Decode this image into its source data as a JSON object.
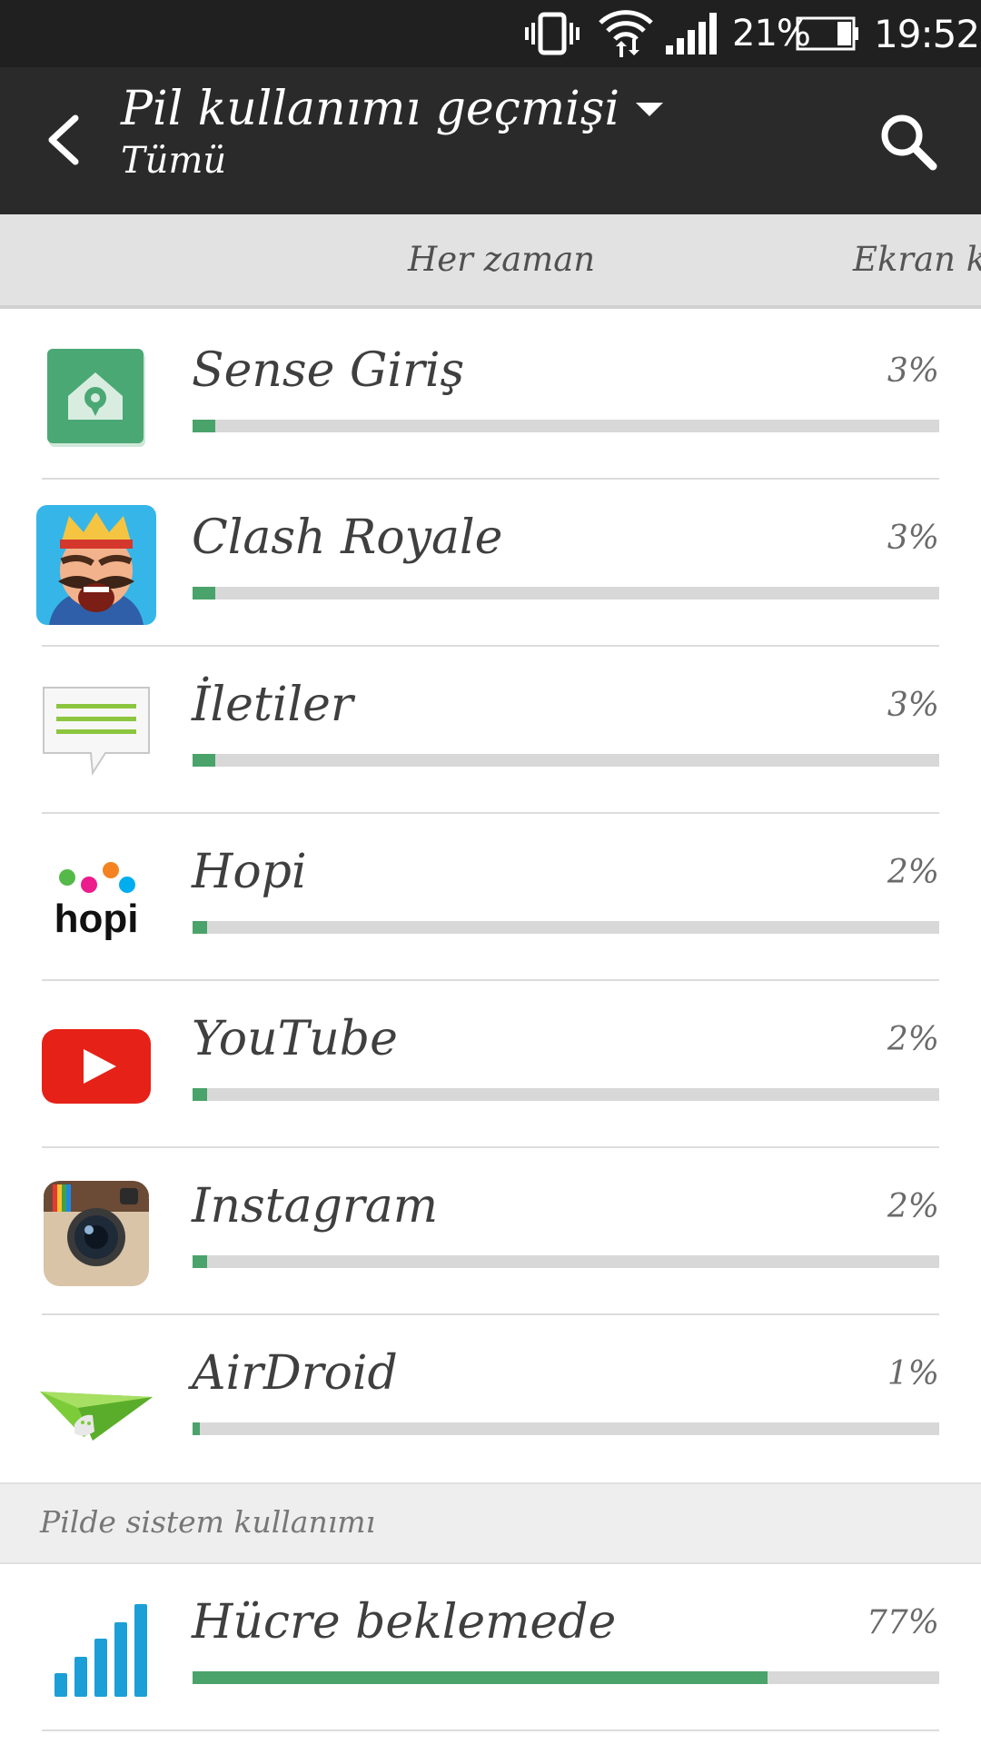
{
  "status_bar": {
    "battery_percent": "21%",
    "time": "19:52",
    "icons": [
      "vibrate-icon",
      "wifi-icon",
      "signal-icon",
      "battery-icon"
    ]
  },
  "app_bar": {
    "title": "Pil kullanımı geçmişi",
    "subtitle": "Tümü",
    "icons": [
      "back-arrow-icon",
      "dropdown-caret-icon",
      "search-icon"
    ]
  },
  "tabs": [
    {
      "label": "Her zaman"
    },
    {
      "label": "Ekran k"
    }
  ],
  "apps": [
    {
      "name": "Sense Giriş",
      "percent": "3%",
      "usage": 3,
      "icon": "sense-home-icon"
    },
    {
      "name": "Clash Royale",
      "percent": "3%",
      "usage": 3,
      "icon": "clash-royale-icon"
    },
    {
      "name": "İletiler",
      "percent": "3%",
      "usage": 3,
      "icon": "messages-icon"
    },
    {
      "name": "Hopi",
      "percent": "2%",
      "usage": 2,
      "icon": "hopi-icon"
    },
    {
      "name": "YouTube",
      "percent": "2%",
      "usage": 2,
      "icon": "youtube-icon"
    },
    {
      "name": "Instagram",
      "percent": "2%",
      "usage": 2,
      "icon": "instagram-icon"
    },
    {
      "name": "AirDroid",
      "percent": "1%",
      "usage": 1,
      "icon": "airdroid-icon"
    }
  ],
  "system_section": {
    "title": "Pilde sistem kullanımı",
    "items": [
      {
        "name": "Hücre beklemede",
        "percent": "77%",
        "usage": 77,
        "icon": "cell-standby-icon"
      }
    ]
  },
  "colors": {
    "usage_bar": "#4aa36a",
    "bar_track": "#d8d8d8",
    "app_bar": "#2a2a2a",
    "status_bar": "#202020"
  }
}
